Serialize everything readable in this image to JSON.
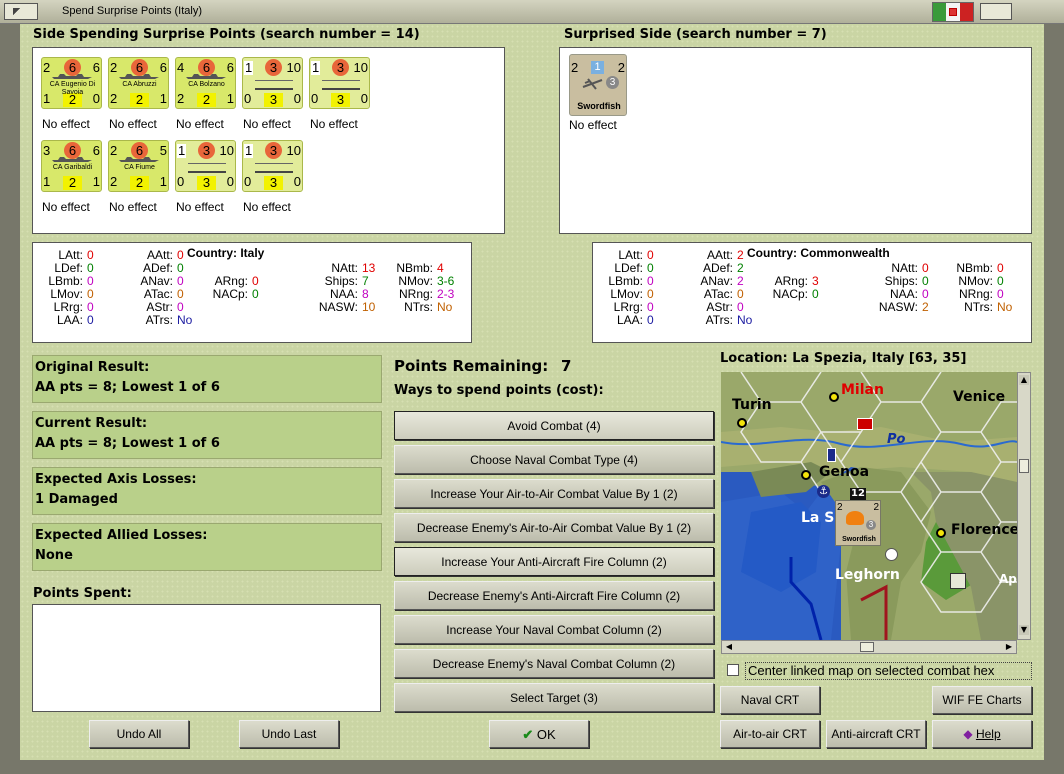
{
  "window": {
    "title": "Spend Surprise Points (Italy)"
  },
  "colors": {
    "panel_green": "#b9d08a",
    "card_yellow": "#d8e86a",
    "red_values": "#e8663a",
    "magenta": "#c000c0",
    "attack_red": "#e00000"
  },
  "spending": {
    "header": "Side Spending Surprise Points (search number = 14)",
    "units": [
      {
        "top_left": "2",
        "top_mid": "6",
        "top_right": "6",
        "name": "CA Eugenio Di Savoia",
        "bot_left": "1",
        "bot_mid": "2",
        "bot_right": "0",
        "effect": "No effect"
      },
      {
        "top_left": "2",
        "top_mid": "6",
        "top_right": "6",
        "name": "CA Abruzzi",
        "bot_left": "2",
        "bot_mid": "2",
        "bot_right": "1",
        "effect": "No effect"
      },
      {
        "top_left": "4",
        "top_mid": "6",
        "top_right": "6",
        "name": "CA Bolzano",
        "bot_left": "2",
        "bot_mid": "2",
        "bot_right": "1",
        "effect": "No effect"
      },
      {
        "top_left": "1",
        "top_mid": "3",
        "top_right": "10",
        "name": "",
        "bot_left": "0",
        "bot_mid": "3",
        "bot_right": "0",
        "effect": "No effect"
      },
      {
        "top_left": "1",
        "top_mid": "3",
        "top_right": "10",
        "name": "",
        "bot_left": "0",
        "bot_mid": "3",
        "bot_right": "0",
        "effect": "No effect"
      },
      {
        "top_left": "3",
        "top_mid": "6",
        "top_right": "6",
        "name": "CA Garibaldi",
        "bot_left": "1",
        "bot_mid": "2",
        "bot_right": "1",
        "effect": "No effect"
      },
      {
        "top_left": "2",
        "top_mid": "6",
        "top_right": "5",
        "name": "CA Fiume",
        "bot_left": "2",
        "bot_mid": "2",
        "bot_right": "1",
        "effect": "No effect"
      },
      {
        "top_left": "1",
        "top_mid": "3",
        "top_right": "10",
        "name": "",
        "bot_left": "0",
        "bot_mid": "3",
        "bot_right": "0",
        "effect": "No effect"
      },
      {
        "top_left": "1",
        "top_mid": "3",
        "top_right": "10",
        "name": "",
        "bot_left": "0",
        "bot_mid": "3",
        "bot_right": "0",
        "effect": "No effect"
      }
    ]
  },
  "surprised": {
    "header": "Surprised Side (search number = 7)",
    "unit": {
      "left": "2",
      "box": "1",
      "right": "2",
      "circle": "3",
      "name": "Swordfish",
      "effect": "No effect"
    }
  },
  "stats_left": {
    "country_label": "Country:",
    "country": "Italy",
    "c1": [
      [
        "LAtt:",
        "0"
      ],
      [
        "LDef:",
        "0"
      ],
      [
        "LBmb:",
        "0"
      ],
      [
        "LMov:",
        "0"
      ],
      [
        "LRrg:",
        "0"
      ],
      [
        "LAA:",
        "0"
      ]
    ],
    "c2": [
      [
        "AAtt:",
        "0"
      ],
      [
        "ADef:",
        "0"
      ],
      [
        "ANav:",
        "0"
      ],
      [
        "ATac:",
        "0"
      ],
      [
        "AStr:",
        "0"
      ],
      [
        "ATrs:",
        "No"
      ]
    ],
    "c3": [
      [
        "ARng:",
        "0"
      ],
      [
        "NACp:",
        "0"
      ]
    ],
    "c4": [
      [
        "NAtt:",
        "13"
      ],
      [
        "Ships:",
        "7"
      ],
      [
        "NAA:",
        "8"
      ],
      [
        "NASW:",
        "10"
      ]
    ],
    "c5": [
      [
        "NBmb:",
        "4"
      ],
      [
        "NMov:",
        "3-6"
      ],
      [
        "NRng:",
        "2-3"
      ],
      [
        "NTrs:",
        "No"
      ]
    ]
  },
  "stats_right": {
    "country_label": "Country:",
    "country": "Commonwealth",
    "c1": [
      [
        "LAtt:",
        "0"
      ],
      [
        "LDef:",
        "0"
      ],
      [
        "LBmb:",
        "0"
      ],
      [
        "LMov:",
        "0"
      ],
      [
        "LRrg:",
        "0"
      ],
      [
        "LAA:",
        "0"
      ]
    ],
    "c2": [
      [
        "AAtt:",
        "2"
      ],
      [
        "ADef:",
        "2"
      ],
      [
        "ANav:",
        "2"
      ],
      [
        "ATac:",
        "0"
      ],
      [
        "AStr:",
        "0"
      ],
      [
        "ATrs:",
        "No"
      ]
    ],
    "c3": [
      [
        "ARng:",
        "3"
      ],
      [
        "NACp:",
        "0"
      ]
    ],
    "c4": [
      [
        "NAtt:",
        "0"
      ],
      [
        "Ships:",
        "0"
      ],
      [
        "NAA:",
        "0"
      ],
      [
        "NASW:",
        "2"
      ]
    ],
    "c5": [
      [
        "NBmb:",
        "0"
      ],
      [
        "NMov:",
        "0"
      ],
      [
        "NRng:",
        "0"
      ],
      [
        "NTrs:",
        "No"
      ]
    ]
  },
  "results": {
    "original_label": "Original Result:",
    "original_value": "AA pts = 8; Lowest 1 of 6",
    "current_label": "Current Result:",
    "current_value": "AA pts = 8; Lowest 1 of 6",
    "axis_label": "Expected Axis Losses:",
    "axis_value": "1 Damaged",
    "allied_label": "Expected Allied Losses:",
    "allied_value": "None",
    "points_spent_label": "Points Spent:"
  },
  "spend": {
    "remaining_label": "Points Remaining:",
    "remaining_value": "7",
    "ways_label": "Ways to spend points (cost):",
    "buttons": [
      "Avoid Combat (4)",
      "Choose Naval Combat Type (4)",
      "Increase Your Air-to-Air Combat Value By 1 (2)",
      "Decrease Enemy's Air-to-Air Combat Value By 1 (2)",
      "Increase Your Anti-Aircraft Fire Column (2)",
      "Decrease Enemy's Anti-Aircraft Fire Column (2)",
      "Increase Your Naval Combat Column (2)",
      "Decrease Enemy's Naval Combat Column (2)",
      "Select Target (3)"
    ]
  },
  "map": {
    "location": "Location: La Spezia, Italy [63, 35]",
    "labels": {
      "milan": "Milan",
      "turin": "Turin",
      "venice": "Venice",
      "po": "Po",
      "genoa": "Genoa",
      "laspezia": "La S",
      "florence": "Florence",
      "leghorn": "Leghorn",
      "ap": "Ap"
    },
    "stack_count": "12",
    "unit_name": "Swordfish",
    "unit_left": "2",
    "unit_right": "2",
    "unit_circle": "3",
    "center_checkbox": "Center linked map on selected combat hex"
  },
  "footer": {
    "undo_all": "Undo All",
    "undo_last": "Undo Last",
    "ok": "OK",
    "naval_crt": "Naval CRT",
    "wif_fe_charts": "WIF FE Charts",
    "air_crt": "Air-to-air CRT",
    "aa_crt": "Anti-aircraft CRT",
    "help": "Help"
  }
}
